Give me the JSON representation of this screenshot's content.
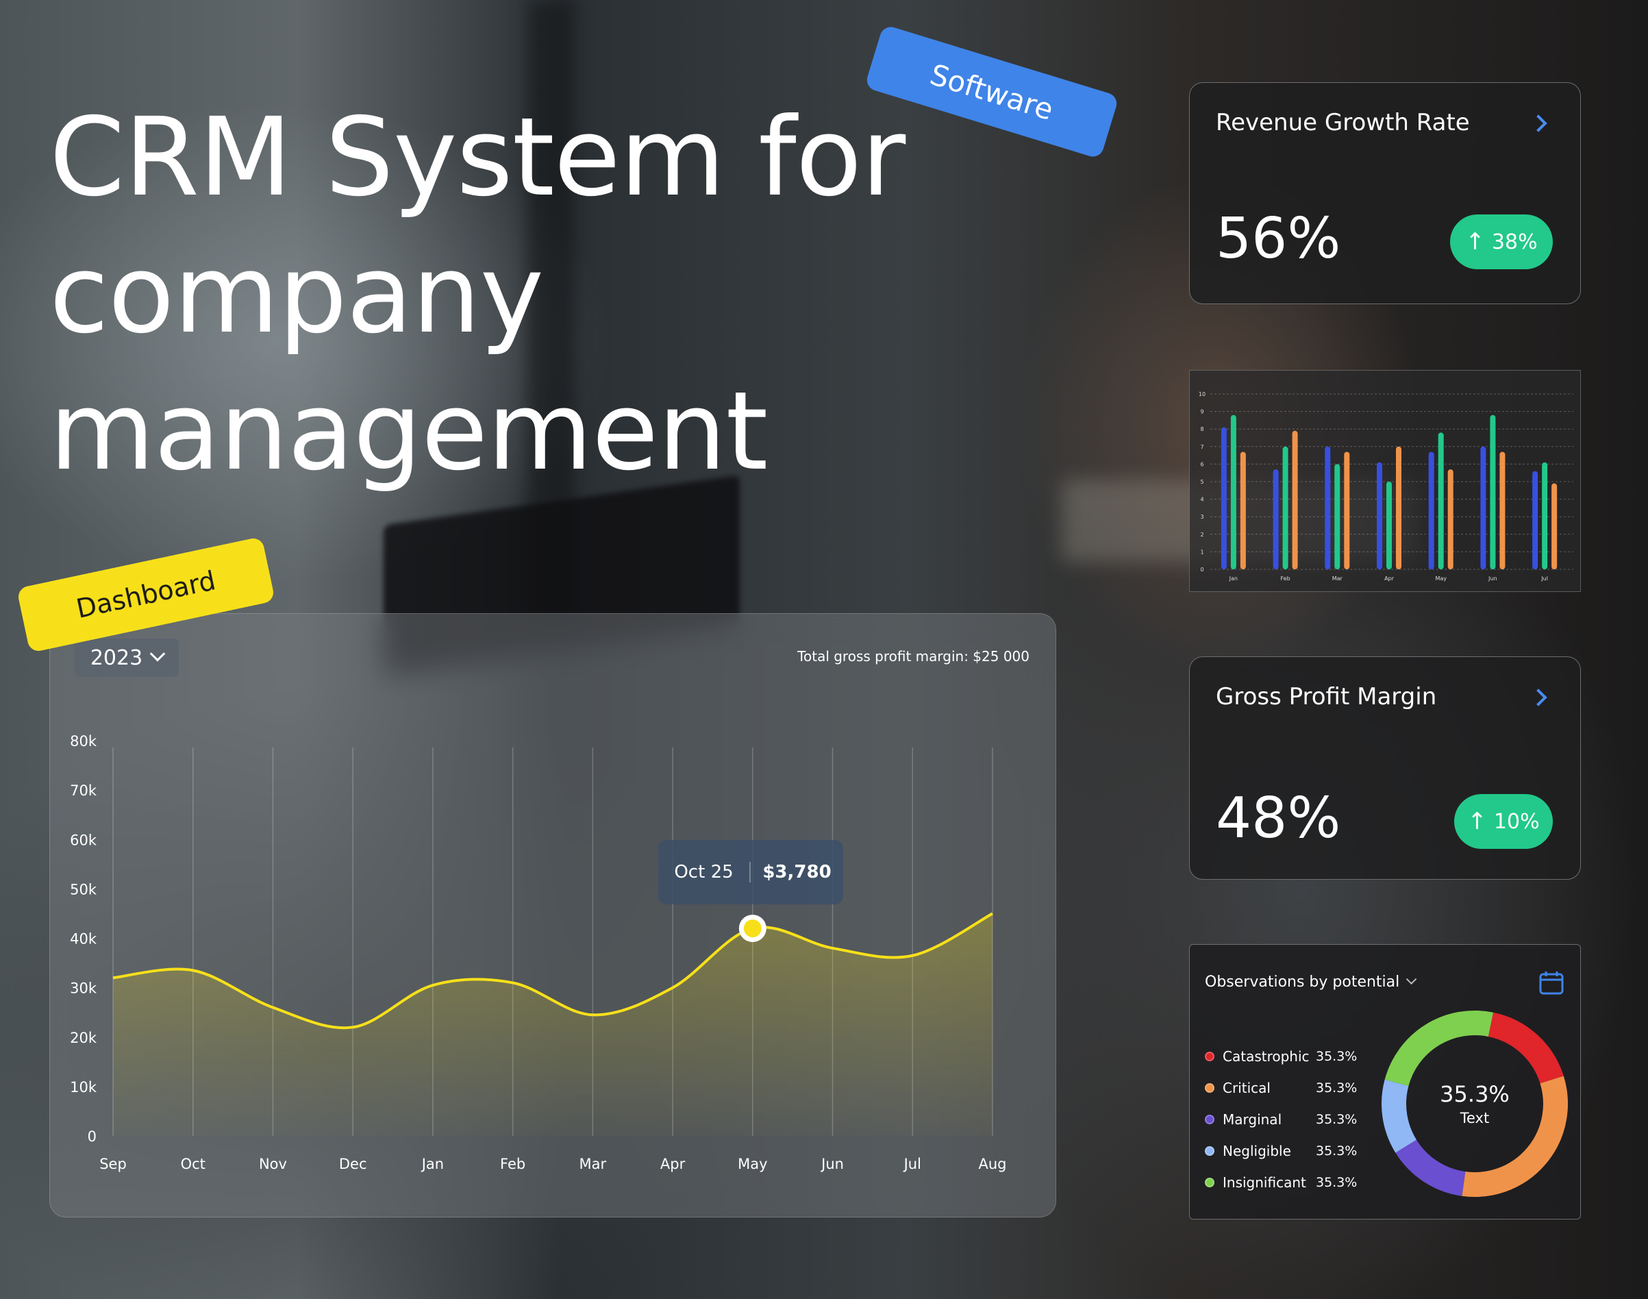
{
  "headline": "CRM System for\ncompany\nmanagement",
  "tags": {
    "software": "Software",
    "dashboard": "Dashboard"
  },
  "main_chart": {
    "year": "2023",
    "total_label": "Total gross profit margin: $25 000",
    "tooltip": {
      "date": "Oct 25",
      "value": "$3,780"
    },
    "accent": "#f7e01a"
  },
  "chart_data": [
    {
      "type": "area",
      "categories": [
        "Sep",
        "Oct",
        "Nov",
        "Dec",
        "Jan",
        "Feb",
        "Mar",
        "Apr",
        "May",
        "Jun",
        "Jul",
        "Aug"
      ],
      "y_ticks": [
        "0",
        "10k",
        "20k",
        "30k",
        "40k",
        "50k",
        "60k",
        "70k",
        "80k"
      ],
      "ylim": [
        0,
        80000
      ],
      "series": [
        {
          "values": [
            32000,
            33500,
            26000,
            22000,
            30500,
            31000,
            24500,
            30000,
            42000,
            38000,
            36500,
            45000
          ]
        }
      ],
      "highlight": {
        "category": "May",
        "value": 42000
      }
    },
    {
      "type": "bar",
      "categories": [
        "Jan",
        "Feb",
        "Mar",
        "Apr",
        "May",
        "Jun",
        "Jul"
      ],
      "y_ticks": [
        "0",
        "1",
        "2",
        "3",
        "4",
        "5",
        "6",
        "7",
        "8",
        "9",
        "10"
      ],
      "ylim": [
        0,
        10
      ],
      "series": [
        {
          "color": "#3850e0",
          "values": [
            8.1,
            5.7,
            7.0,
            6.1,
            6.7,
            7.0,
            5.6
          ]
        },
        {
          "color": "#22c98a",
          "values": [
            8.8,
            7.0,
            6.0,
            5.0,
            7.8,
            8.8,
            6.1
          ]
        },
        {
          "color": "#f0934a",
          "values": [
            6.7,
            7.9,
            6.7,
            7.0,
            5.7,
            6.7,
            4.9
          ]
        }
      ]
    },
    {
      "type": "pie",
      "title": "Observations by potential",
      "center_value": "35.3%",
      "center_label": "Text",
      "series": [
        {
          "name": "Catastrophic",
          "value": "35.3%",
          "color": "#e0252b",
          "share": 0.17
        },
        {
          "name": "Critical",
          "value": "35.3%",
          "color": "#f0934a",
          "share": 0.32
        },
        {
          "name": "Marginal",
          "value": "35.3%",
          "color": "#6a4fd0",
          "share": 0.14
        },
        {
          "name": "Negligible",
          "value": "35.3%",
          "color": "#8fb8f5",
          "share": 0.13
        },
        {
          "name": "Insignificant",
          "value": "35.3%",
          "color": "#7fd04f",
          "share": 0.24
        }
      ]
    }
  ],
  "kpis": [
    {
      "title": "Revenue Growth Rate",
      "value": "56%",
      "change": "38%",
      "color": "#22c98a"
    },
    {
      "title": "Gross Profit Margin",
      "value": "48%",
      "change": "10%",
      "color": "#22c98a"
    }
  ]
}
